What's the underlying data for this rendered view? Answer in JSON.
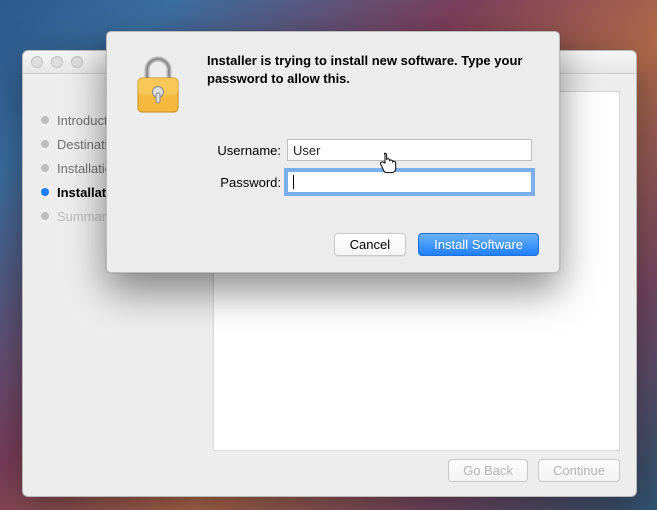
{
  "installer": {
    "steps": [
      {
        "label": "Introduction",
        "state": "done"
      },
      {
        "label": "Destination Select",
        "state": "done"
      },
      {
        "label": "Installation Type",
        "state": "done"
      },
      {
        "label": "Installation",
        "state": "current"
      },
      {
        "label": "Summary",
        "state": "future"
      }
    ],
    "buttons": {
      "back": "Go Back",
      "continue": "Continue"
    }
  },
  "auth": {
    "message": "Installer is trying to install new software. Type your password to allow this.",
    "labels": {
      "username": "Username:",
      "password": "Password:"
    },
    "values": {
      "username": "User",
      "password": ""
    },
    "buttons": {
      "cancel": "Cancel",
      "install": "Install Software"
    }
  }
}
